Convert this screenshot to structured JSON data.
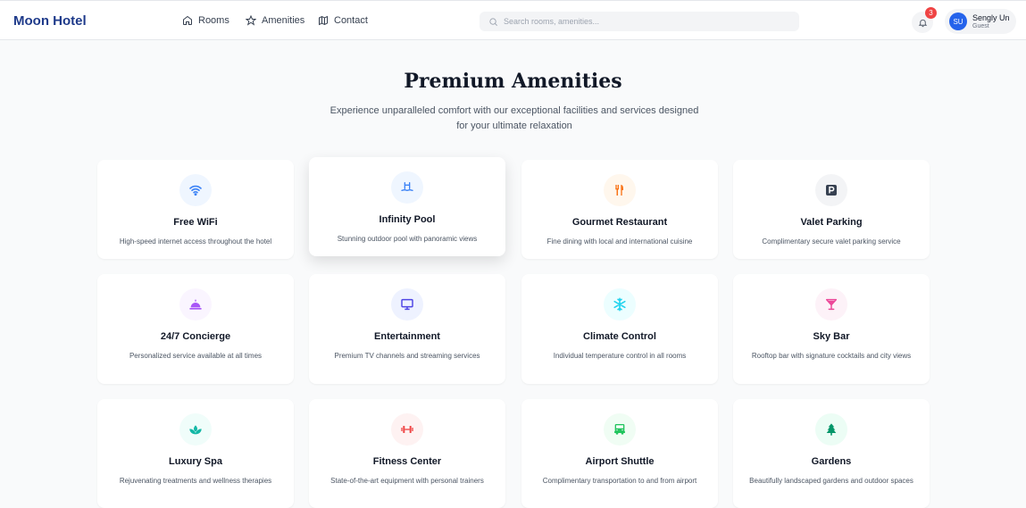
{
  "header": {
    "brand": "Moon Hotel",
    "nav": [
      {
        "label": "Rooms",
        "icon": "home-icon"
      },
      {
        "label": "Amenities",
        "icon": "star-icon"
      },
      {
        "label": "Contact",
        "icon": "map-icon"
      }
    ],
    "search_placeholder": "Search rooms, amenities...",
    "notification_count": "3",
    "user": {
      "initials": "SU",
      "name": "Sengly Un",
      "role": "Guest"
    }
  },
  "hero": {
    "title": "Premium Amenities",
    "subtitle": "Experience unparalleled comfort with our exceptional facilities and services designed for your ultimate relaxation"
  },
  "amenities": [
    {
      "title": "Free WiFi",
      "desc": "High-speed internet access throughout the hotel",
      "icon": "wifi-icon",
      "color": "#3b82f6",
      "bg": "#eff6ff"
    },
    {
      "title": "Infinity Pool",
      "desc": "Stunning outdoor pool with panoramic views",
      "icon": "pool-icon",
      "color": "#3b82f6",
      "bg": "#eff6ff"
    },
    {
      "title": "Gourmet Restaurant",
      "desc": "Fine dining with local and international cuisine",
      "icon": "utensils-icon",
      "color": "#f97316",
      "bg": "#fff7ed"
    },
    {
      "title": "Valet Parking",
      "desc": "Complimentary secure valet parking service",
      "icon": "parking-icon",
      "color": "#374151",
      "bg": "#f3f4f6"
    },
    {
      "title": "24/7 Concierge",
      "desc": "Personalized service available at all times",
      "icon": "concierge-bell-icon",
      "color": "#a855f7",
      "bg": "#faf5ff"
    },
    {
      "title": "Entertainment",
      "desc": "Premium TV channels and streaming services",
      "icon": "tv-icon",
      "color": "#4f46e5",
      "bg": "#eef2ff"
    },
    {
      "title": "Climate Control",
      "desc": "Individual temperature control in all rooms",
      "icon": "snowflake-icon",
      "color": "#22d3ee",
      "bg": "#ecfeff"
    },
    {
      "title": "Sky Bar",
      "desc": "Rooftop bar with signature cocktails and city views",
      "icon": "cocktail-icon",
      "color": "#ec4899",
      "bg": "#fdf2f8"
    },
    {
      "title": "Luxury Spa",
      "desc": "Rejuvenating treatments and wellness therapies",
      "icon": "spa-icon",
      "color": "#14b8a6",
      "bg": "#f0fdfa"
    },
    {
      "title": "Fitness Center",
      "desc": "State-of-the-art equipment with personal trainers",
      "icon": "dumbbell-icon",
      "color": "#ef4444",
      "bg": "#fef2f2"
    },
    {
      "title": "Airport Shuttle",
      "desc": "Complimentary transportation to and from airport",
      "icon": "shuttle-icon",
      "color": "#22c55e",
      "bg": "#f0fdf4"
    },
    {
      "title": "Gardens",
      "desc": "Beautifully landscaped gardens and outdoor spaces",
      "icon": "tree-icon",
      "color": "#059669",
      "bg": "#ecfdf5"
    }
  ]
}
